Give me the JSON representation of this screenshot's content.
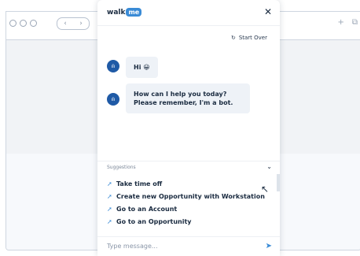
{
  "widget": {
    "logo_text": "walk",
    "logo_badge": "me",
    "start_over": "Start Over",
    "messages": [
      {
        "text": "Hi 😀"
      },
      {
        "text": "How can I help you today? Please remember, I'm a bot."
      }
    ],
    "suggestions_title": "Suggestions",
    "suggestions": [
      "Take time off",
      "Create new Opportunity with Workstation",
      "Go to an Account",
      "Go to an Opportunity"
    ],
    "input_placeholder": "Type message..."
  },
  "icons": {
    "close": "close-icon",
    "refresh": "refresh-icon",
    "send": "send-icon",
    "bot": "bot-avatar-icon",
    "suggestion": "rocket-icon",
    "collapse": "chevron-down-icon"
  },
  "colors": {
    "accent": "#3a8bd6",
    "avatar": "#1f5aa6"
  }
}
